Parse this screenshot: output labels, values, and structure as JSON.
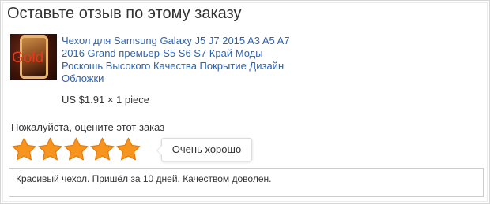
{
  "page_title": "Оставьте отзыв по этому заказу",
  "product": {
    "image_logo_text": "Gold",
    "title": "Чехол для Samsung Galaxy J5 J7 2015 A3 A5 A7 2016 Grand премьер-S5 S6 S7 Край Моды Роскошь Высокого Качества Покрытие Дизайн Обложки",
    "price": "US $1.91 × 1 piece"
  },
  "rating": {
    "label": "Пожалуйста, оцените этот заказ",
    "value": 5,
    "max": 5,
    "tooltip": "Очень хорошо",
    "star_color": "#f7941d"
  },
  "review": {
    "text": "Красивый чехол. Пришёл за 10 дней. Качеством доволен."
  }
}
